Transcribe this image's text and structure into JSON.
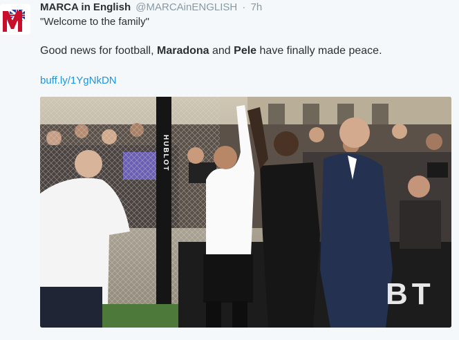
{
  "tweet": {
    "author_name": "MARCA in English",
    "handle": "@MARCAinENGLISH",
    "separator": "·",
    "time": "7h",
    "quote": "\"Welcome to the family\"",
    "text_before": "Good news for football, ",
    "name_1": "Maradona",
    "text_middle": " and ",
    "name_2": "Pele",
    "text_after": " have finally made peace.",
    "link": "buff.ly/1YgNkDN"
  },
  "photo": {
    "hublot_post_text": "HUBLOT",
    "banner_text": "BT",
    "description_icon": "photo-image"
  },
  "colors": {
    "background": "#f5f8fa",
    "link": "#1b95e0",
    "muted": "#8899a6",
    "text": "#292f33",
    "brand_red": "#c8102e"
  }
}
